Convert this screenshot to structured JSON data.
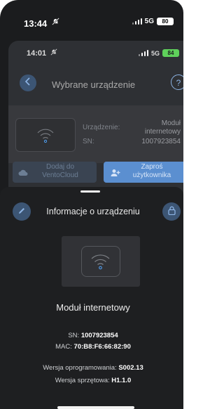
{
  "outer_status": {
    "time": "13:44",
    "network": "5G",
    "battery": "80"
  },
  "inner_status": {
    "time": "14:01",
    "network": "5G",
    "battery": "84"
  },
  "background_screen": {
    "title": "Wybrane urządzenie",
    "device_label": "Urządzenie:",
    "device_value": "Moduł internetowy",
    "sn_label": "SN:",
    "sn_value": "1007923854",
    "cloud_button_label": "Dodaj do VentoCloud",
    "invite_button_label": "Zaproś użytkownika"
  },
  "sheet": {
    "title": "Informacje o urządzeniu",
    "device_name": "Moduł internetowy",
    "sn_label": "SN:",
    "sn_value": "1007923854",
    "mac_label": "MAC:",
    "mac_value": "70:B8:F6:66:82:90",
    "firmware_label": "Wersja oprogramowania:",
    "firmware_value": "S002.13",
    "hardware_label": "Wersja sprzętowa:",
    "hardware_value": "H1.1.0"
  },
  "icons": {
    "mute": "bell-slash-icon",
    "signal": "signal-bars-icon",
    "back": "chevron-left-icon",
    "help": "question-icon",
    "wifi": "wifi-icon",
    "cloud": "cloud-icon",
    "add_user": "user-plus-icon",
    "edit": "pencil-icon",
    "lock": "lock-icon"
  },
  "colors": {
    "accent": "#5b8fd0",
    "accent_icon": "#8db4e4",
    "wifi_dot": "#4f9ef0"
  }
}
